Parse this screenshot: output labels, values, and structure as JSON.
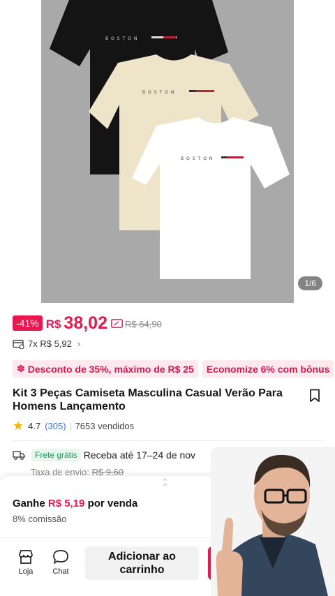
{
  "gallery": {
    "counter": "1/6",
    "shirt_text": "BOSTON",
    "bg_color": "#a9a9a9"
  },
  "price": {
    "discount": "-41%",
    "currency": "R$",
    "value": "38,02",
    "old": "R$ 64,90",
    "installments": "7x R$ 5,92"
  },
  "promos": [
    {
      "label": "Desconto de 35%, máximo de R$ 25"
    },
    {
      "label": "Economize 6% com bônus"
    }
  ],
  "product": {
    "title": "Kit 3 Peças  Camiseta Masculina Casual Verão Para Homens Lançamento",
    "rating": "4.7",
    "reviews": "(305)",
    "sold": "7653 vendidos"
  },
  "shipping": {
    "free_label": "Frete grátis",
    "delivery": "Receba até 17–24 de nov",
    "tax_label": "Taxa de envio:",
    "tax_old": "R$ 9,60"
  },
  "affiliate": {
    "earn_prefix": "Ganhe",
    "earn_amount": "R$ 5,19",
    "earn_suffix": "por venda",
    "commission": "8% comissão"
  },
  "bottom_bar": {
    "shop_label": "Loja",
    "chat_label": "Chat",
    "cart_label": "Adicionar ao carrinho"
  },
  "colors": {
    "accent": "#e8174f",
    "free_ship": "#1a9b5c",
    "link": "#3a6fd8"
  }
}
